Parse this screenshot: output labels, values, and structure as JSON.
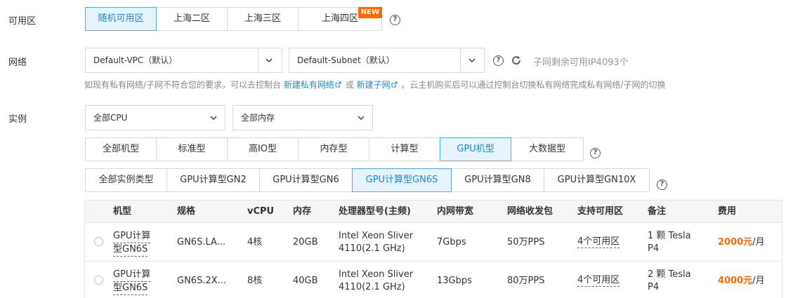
{
  "zone": {
    "label": "可用区",
    "options": [
      "随机可用区",
      "上海二区",
      "上海三区",
      "上海四区"
    ],
    "active_index": 0,
    "new_badge": "NEW"
  },
  "network": {
    "label": "网络",
    "vpc_select": "Default-VPC（默认）",
    "subnet_select": "Default-Subnet（默认）",
    "remaining_ip": "子网剩余可用IP4093个",
    "hint_prefix": "如现有私有网络/子网不符合您的要求，可以去控制台",
    "hint_link1": "新建私有网络",
    "hint_mid": "或",
    "hint_link2": "新建子网",
    "hint_suffix": "。云主机购买后可以通过控制台切换私有网络完成私有网络/子网的切换"
  },
  "instance": {
    "label": "实例",
    "cpu_select": "全部CPU",
    "memory_select": "全部内存",
    "categories": [
      "全部机型",
      "标准型",
      "高IO型",
      "内存型",
      "计算型",
      "GPU机型",
      "大数据型"
    ],
    "categories_active": 5,
    "types": [
      "全部实例类型",
      "GPU计算型GN2",
      "GPU计算型GN6",
      "GPU计算型GN6S",
      "GPU计算型GN8",
      "GPU计算型GN10X"
    ],
    "types_active": 3
  },
  "table": {
    "headers": {
      "model": "机型",
      "spec": "规格",
      "vcpu": "vCPU",
      "memory": "内存",
      "cpu_model": "处理器型号(主频)",
      "bandwidth": "内网带宽",
      "pps": "网络收发包",
      "zones": "支持可用区",
      "note": "备注",
      "fee": "费用"
    },
    "rows": [
      {
        "model_line1": "GPU计算",
        "model_line2": "型GN6S",
        "spec": "GN6S.LA...",
        "vcpu": "4核",
        "memory": "20GB",
        "cpu_line1": "Intel Xeon Sliver",
        "cpu_line2": "4110(2.1 GHz)",
        "bandwidth": "7Gbps",
        "pps": "50万PPS",
        "zones": "4个可用区",
        "note_line1": "1 颗 Tesla",
        "note_line2": "P4",
        "price": "2000元",
        "price_unit": "/月"
      },
      {
        "model_line1": "GPU计算",
        "model_line2": "型GN6S",
        "spec": "GN6S.2X...",
        "vcpu": "8核",
        "memory": "40GB",
        "cpu_line1": "Intel Xeon Sliver",
        "cpu_line2": "4110(2.1 GHz)",
        "bandwidth": "13Gbps",
        "pps": "80万PPS",
        "zones": "4个可用区",
        "note_line1": "2 颗 Tesla",
        "note_line2": "P4",
        "price": "4000元",
        "price_unit": "/月"
      }
    ]
  },
  "colors": {
    "accent": "#1e88d4",
    "active_bg": "#e6f3fc",
    "price": "#ff6a00"
  }
}
